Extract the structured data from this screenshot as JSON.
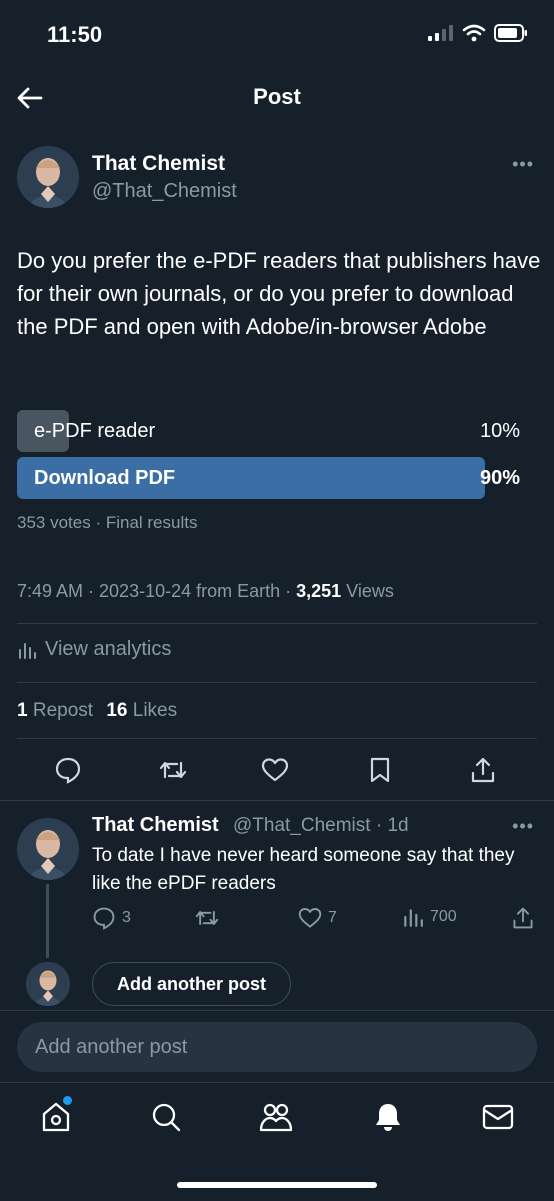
{
  "status_bar": {
    "time": "11:50"
  },
  "header": {
    "title": "Post"
  },
  "post": {
    "author_name": "That Chemist",
    "author_handle": "@That_Chemist",
    "text": "Do you prefer the e-PDF readers that publishers have for their own journals, or do you prefer to download the PDF and open with Adobe/in-browser Adobe",
    "poll": {
      "options": [
        {
          "label": "e-PDF reader",
          "percent": "10%",
          "fraction": 0.1
        },
        {
          "label": "Download PDF",
          "percent": "90%",
          "fraction": 0.9
        }
      ],
      "summary": "353 votes · Final results"
    },
    "meta_prefix": "7:49 AM · 2023-10-24 from Earth · ",
    "views_count": "3,251",
    "views_label": " Views",
    "analytics_label": "View analytics",
    "reposts_count": "1",
    "reposts_label": "Repost",
    "likes_count": "16",
    "likes_label": "Likes"
  },
  "reply": {
    "author_name": "That Chemist",
    "author_handle": "@That_Chemist · 1d",
    "text": "To date I have never heard someone say that they like the ePDF readers",
    "replies": "3",
    "likes": "7",
    "views": "700"
  },
  "thread_button": "Add another post",
  "composer_placeholder": "Add another post",
  "colors": {
    "background": "#15202b",
    "poll_winner": "#3a6ea5",
    "poll_loser": "#4a5562",
    "muted_text": "#8b98a5",
    "notification_dot": "#1d9bf0"
  }
}
